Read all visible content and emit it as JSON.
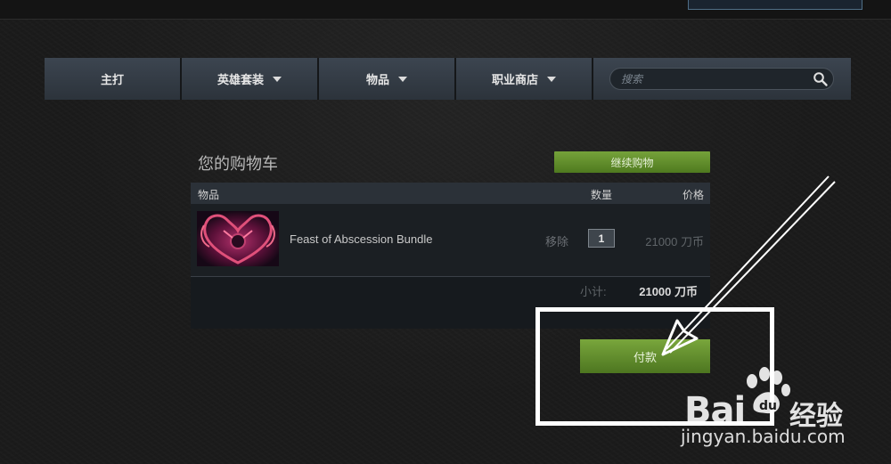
{
  "nav": {
    "items": [
      {
        "label": "主打",
        "dropdown": false
      },
      {
        "label": "英雄套装",
        "dropdown": true
      },
      {
        "label": "物品",
        "dropdown": true
      },
      {
        "label": "职业商店",
        "dropdown": true
      }
    ],
    "search_placeholder": "搜索"
  },
  "cart": {
    "title": "您的购物车",
    "continue_label": "继续购物",
    "columns": {
      "item": "物品",
      "quantity": "数量",
      "price": "价格"
    },
    "items": [
      {
        "name": "Feast of Abscession Bundle",
        "remove_label": "移除",
        "quantity": "1",
        "price": "21000 刀币"
      }
    ],
    "subtotal_label": "小计:",
    "subtotal_value": "21000 刀币",
    "pay_label": "付款"
  },
  "watermark": {
    "brand": "Bai",
    "brand_suffix": "经验",
    "url": "jingyan.baidu.com"
  },
  "colors": {
    "accent_green": "#5f8c2b",
    "nav_bg": "#343c45",
    "highlight": "#ffffff"
  }
}
